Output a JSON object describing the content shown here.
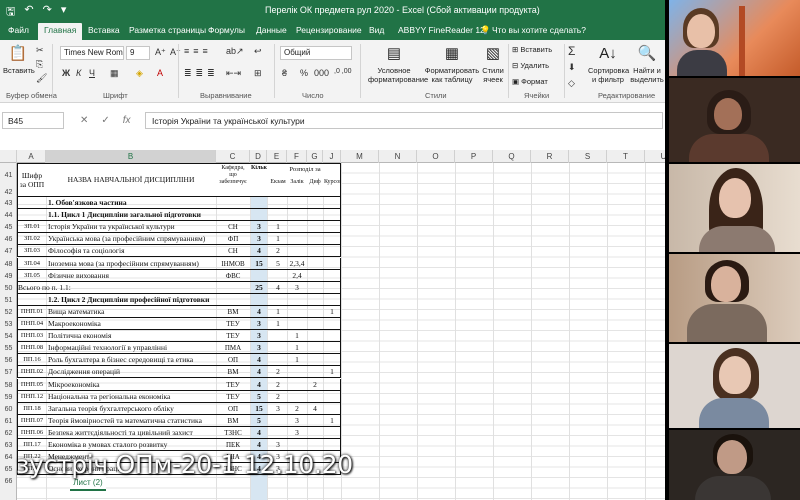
{
  "titlebar": {
    "title": "Перелік ОК предмета рул 2020 - Excel (Сбой активации продукта)"
  },
  "tabs": [
    "Файл",
    "Главная",
    "Вставка",
    "Разметка страницы",
    "Формулы",
    "Данные",
    "Рецензирование",
    "Вид",
    "ABBYY FineReader 12",
    "Что вы хотите сделать?"
  ],
  "ribbon": {
    "paste": "Вставить",
    "font_name": "Times New Roma",
    "font_size": "9",
    "number_format": "Общий",
    "conditional": "Условное форматирование",
    "format_table": "Форматировать как таблицу",
    "cell_styles": "Стили ячеек",
    "insert": "Вставить",
    "delete": "Удалить",
    "format": "Формат",
    "sort": "Сортировка и фильтр",
    "find": "Найти и выделить",
    "groups": [
      "Буфер обмена",
      "Шрифт",
      "Выравнивание",
      "Число",
      "Стили",
      "Ячейки",
      "Редактирование"
    ]
  },
  "formula_bar": {
    "name_box": "B45",
    "formula": "Історія України та української культури"
  },
  "columns": [
    "A",
    "B",
    "C",
    "D",
    "E",
    "F",
    "G",
    "J",
    "M",
    "N",
    "O",
    "P",
    "Q",
    "R",
    "S",
    "T",
    "U"
  ],
  "rows": [
    "41",
    "42",
    "43",
    "44",
    "45",
    "46",
    "47",
    "48",
    "49",
    "50",
    "51",
    "52",
    "53",
    "54",
    "55",
    "56",
    "57",
    "58",
    "59",
    "60",
    "61",
    "62",
    "63",
    "64",
    "65",
    "66"
  ],
  "header": {
    "cipher": "Шифр за ОПП",
    "name": "НАЗВА НАВЧАЛЬНОЇ ДИСЦИПЛІНИ",
    "dept": "Кафедра, що забезпечує",
    "credits": "Кількість",
    "distribution": "Розподіл за",
    "exam": "Екзам",
    "credit_test": "Залік",
    "dz": "Диф",
    "coursework": "Курсова"
  },
  "table_rows": [
    {
      "a": "",
      "b": "1. Обов'язкова частина",
      "c": "",
      "d": "",
      "e": "",
      "f": "",
      "g": "",
      "j": "",
      "bold": true
    },
    {
      "a": "",
      "b": "1.1. Цикл 1 Дисципліни загальної підготовки",
      "c": "",
      "d": "",
      "e": "",
      "f": "",
      "g": "",
      "j": "",
      "bold": true
    },
    {
      "a": "ЗП.01",
      "b": "Історія України та української культури",
      "c": "СН",
      "d": "3",
      "e": "1",
      "f": "",
      "g": "",
      "j": ""
    },
    {
      "a": "ЗП.02",
      "b": "Українська мова (за професійним спрямуванням)",
      "c": "ФП",
      "d": "3",
      "e": "1",
      "f": "",
      "g": "",
      "j": ""
    },
    {
      "a": "ЗП.03",
      "b": "Філософія та соціологія",
      "c": "СН",
      "d": "4",
      "e": "2",
      "f": "",
      "g": "",
      "j": ""
    },
    {
      "a": "ЗП.04",
      "b": "Іноземна мова (за професійним спрямуванням)",
      "c": "ІНМОВ",
      "d": "15",
      "e": "5",
      "f": "2,3,4",
      "g": "",
      "j": ""
    },
    {
      "a": "ЗП.05",
      "b": "Фізичне виховання",
      "c": "ФВС",
      "d": "",
      "e": "",
      "f": "2,4",
      "g": "",
      "j": ""
    },
    {
      "a": "Всього по п. 1.1:",
      "b": "",
      "c": "",
      "d": "25",
      "e": "4",
      "f": "3",
      "g": "",
      "j": ""
    },
    {
      "a": "",
      "b": "1.2. Цикл 2 Дисципліни професійної підготовки",
      "c": "",
      "d": "",
      "e": "",
      "f": "",
      "g": "",
      "j": "",
      "bold": true
    },
    {
      "a": "ПНП.01",
      "b": "Вища математика",
      "c": "ВМ",
      "d": "4",
      "e": "1",
      "f": "",
      "g": "",
      "j": "1"
    },
    {
      "a": "ПНП.04",
      "b": "Макроекономіка",
      "c": "ТЕУ",
      "d": "3",
      "e": "1",
      "f": "",
      "g": "",
      "j": ""
    },
    {
      "a": "ПНП.03",
      "b": "Політична економія",
      "c": "ТЕУ",
      "d": "3",
      "e": "",
      "f": "1",
      "g": "",
      "j": ""
    },
    {
      "a": "ПНП.08",
      "b": "Інформаційні технології в управлінні",
      "c": "ПМА",
      "d": "3",
      "e": "",
      "f": "1",
      "g": "",
      "j": ""
    },
    {
      "a": "ПП.16",
      "b": "Роль бухгалтера в бізнес середовищі та етика",
      "c": "ОП",
      "d": "4",
      "e": "",
      "f": "1",
      "g": "",
      "j": ""
    },
    {
      "a": "ПНП.02",
      "b": "Дослідження операцій",
      "c": "ВМ",
      "d": "4",
      "e": "2",
      "f": "",
      "g": "",
      "j": "1"
    },
    {
      "a": "ПНП.05",
      "b": "Мікроекономіка",
      "c": "ТЕУ",
      "d": "4",
      "e": "2",
      "f": "",
      "g": "2",
      "j": ""
    },
    {
      "a": "ПНП.12",
      "b": "Національна та регіональна економіка",
      "c": "ТЕУ",
      "d": "5",
      "e": "2",
      "f": "",
      "g": "",
      "j": ""
    },
    {
      "a": "ПП.18",
      "b": "Загальна теорія бухгалтерського обліку",
      "c": "ОП",
      "d": "15",
      "e": "3",
      "f": "2",
      "g": "4",
      "j": ""
    },
    {
      "a": "ПНП.07",
      "b": "Теорія ймовірностей та математична статистика",
      "c": "ВМ",
      "d": "5",
      "e": "",
      "f": "3",
      "g": "",
      "j": "1"
    },
    {
      "a": "ПНП.06",
      "b": "Безпека життєдіяльності та цивільний захист",
      "c": "ТЗНС",
      "d": "4",
      "e": "",
      "f": "3",
      "g": "",
      "j": ""
    },
    {
      "a": "ПП.17",
      "b": "Економіка в умовах сталого розвитку",
      "c": "ПЕК",
      "d": "4",
      "e": "3",
      "f": "",
      "g": "",
      "j": ""
    },
    {
      "a": "ПП.22",
      "b": "Менеджмент",
      "c": "МІА",
      "d": "4",
      "e": "3",
      "f": "",
      "g": "",
      "j": ""
    },
    {
      "a": "ПП.10",
      "b": "Основи охорони праці",
      "c": "ТЗНС",
      "d": "4",
      "e": "3",
      "f": "",
      "g": "",
      "j": ""
    }
  ],
  "sheet_tab": "Лист (2)",
  "caption": "зустріч ОПм-20-1 12.10.20",
  "colors": {
    "excel_green": "#217346",
    "ribbon_bg": "#f3f3f3",
    "selected_col": "#d7e6f2"
  }
}
